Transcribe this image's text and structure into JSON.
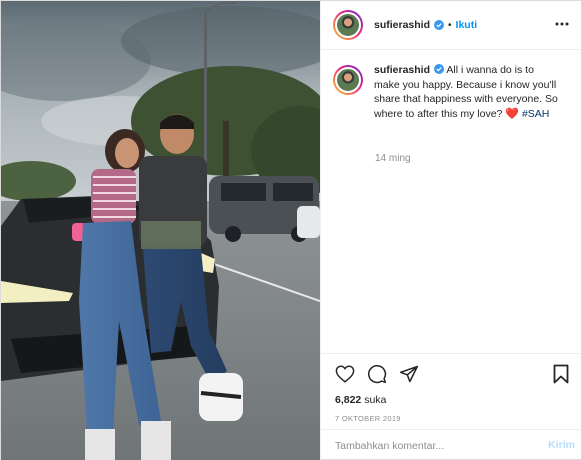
{
  "post": {
    "username": "sufierashid",
    "verified": true,
    "separator": "•",
    "follow_label": "Ikuti",
    "more_icon": "more-horizontal-icon"
  },
  "caption": {
    "username": "sufierashid",
    "text": "All i wanna do is to make you happy. Because i know you'll share that happiness with everyone. So where to after this my love?",
    "emoji": "❤️",
    "hashtag": "#SAH",
    "time_ago": "14 ming"
  },
  "actions": {
    "like_icon": "heart-icon",
    "comment_icon": "comment-icon",
    "share_icon": "share-icon",
    "save_icon": "bookmark-icon"
  },
  "likes": {
    "count": "6,822",
    "label": "suka"
  },
  "date": "7 OKTOBER 2019",
  "comment": {
    "placeholder": "Tambahkan komentar...",
    "post_label": "Kirim"
  },
  "colors": {
    "link_blue": "#0095f6",
    "post_disabled": "#b2dffc",
    "heart_red": "#ed4956",
    "muted": "#8e8e8e"
  }
}
